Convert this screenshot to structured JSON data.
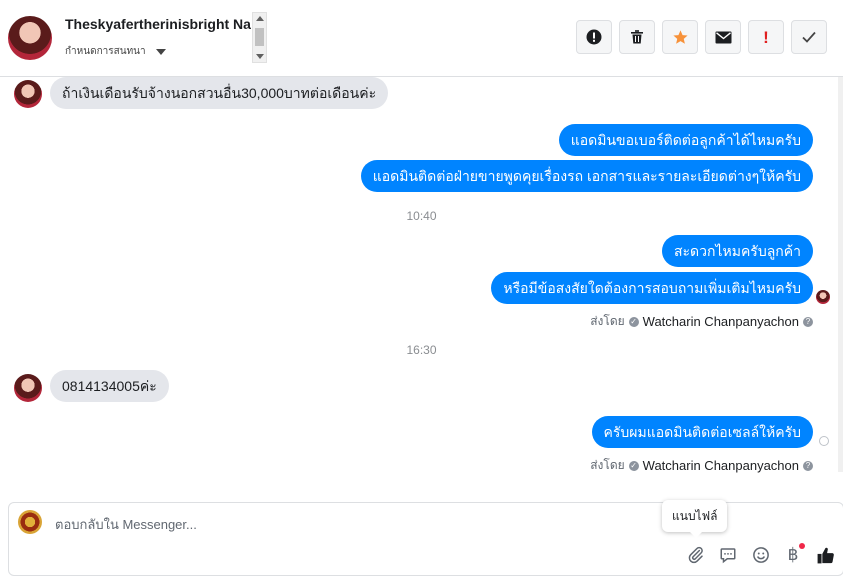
{
  "header": {
    "contact_name": "Theskyafertherinisbright Nat",
    "assign_label": "กำหนดการสนทนา",
    "actions": [
      {
        "name": "spam-icon",
        "label": "!"
      },
      {
        "name": "trash-icon"
      },
      {
        "name": "star-icon",
        "color": "#f7923a"
      },
      {
        "name": "mail-icon"
      },
      {
        "name": "important-icon",
        "label": "!",
        "color": "#e02020"
      },
      {
        "name": "check-icon"
      }
    ]
  },
  "messages": {
    "m1": "ถ้าเงินเดือนรับจ้างนอกสวนอื่น30,000บาทต่อเดือนค่ะ",
    "m2": "แอดมินขอเบอร์ติดต่อลูกค้าได้ไหมครับ",
    "m3": "แอดมินติดต่อฝ่ายขายพูดคุยเรื่องรถ เอกสารและรายละเอียดต่างๆให้ครับ",
    "time1": "10:40",
    "m4": "สะดวกไหมครับลูกค้า",
    "m5": "หรือมีข้อสงสัยใดต้องการสอบถามเพิ่มเติมไหมครับ",
    "sent_by_1": {
      "prefix": "ส่งโดย",
      "agent": "Watcharin Chanpanyachon"
    },
    "time2": "16:30",
    "m6": "0814134005ค่ะ",
    "m7": "ครับผมแอดมินติดต่อเซลล์ให้ครับ",
    "sent_by_2": {
      "prefix": "ส่งโดย",
      "agent": "Watcharin Chanpanyachon"
    }
  },
  "composer": {
    "placeholder": "ตอบกลับใน Messenger...",
    "tooltip": "แนบไฟล์",
    "icons": [
      "paperclip-icon",
      "saved-reply-icon",
      "emoji-icon",
      "baht-icon",
      "like-icon"
    ]
  },
  "colors": {
    "outgoing_bubble": "#0084ff",
    "incoming_bubble": "#e4e6eb",
    "star": "#f7923a",
    "important": "#e02020",
    "notification_dot": "#f02849"
  }
}
